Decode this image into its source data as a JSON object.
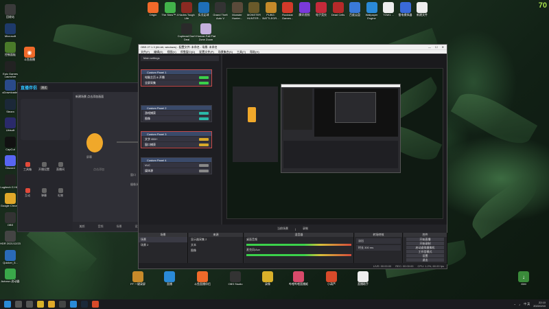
{
  "desktop": {
    "corner_number": "70",
    "top_icons": [
      {
        "label": "Origin",
        "color": "#f06a2a",
        "name": "origin-icon"
      },
      {
        "label": "The Sims™ 4",
        "color": "#42b34a",
        "name": "sims-icon"
      },
      {
        "label": "Hades Tough Life",
        "color": "#8a2a22",
        "name": "hades-icon"
      },
      {
        "label": "实况足球",
        "color": "#1e6fb8",
        "name": "football-icon"
      },
      {
        "label": "Grand Theft Auto V",
        "color": "#333",
        "name": "gta-icon"
      },
      {
        "label": "Monster Hunter...",
        "color": "#5a4a3a",
        "name": "monster-hunter-icon"
      },
      {
        "label": "MONSTER HUNTER...",
        "color": "#6a5a2a",
        "name": "monster-hunter-2-icon"
      },
      {
        "label": "PUBG: BATTLEGR...",
        "color": "#c48a2a",
        "name": "pubg-icon"
      },
      {
        "label": "Rockstar Games...",
        "color": "#d23a2a",
        "name": "rockstar-icon"
      },
      {
        "label": "腾讯视频",
        "color": "#7a3adb",
        "name": "tencent-video-icon"
      },
      {
        "label": "电子竞技",
        "color": "#c42a3a",
        "name": "esports-icon"
      },
      {
        "label": "Dead Cells",
        "color": "#b62a2a",
        "name": "dead-cells-icon"
      },
      {
        "label": "百度云盘",
        "color": "#3a7ad8",
        "name": "baidu-cloud-icon"
      },
      {
        "label": "Wallpaper Engine",
        "color": "#2a8ad8",
        "name": "wallpaper-engine-icon"
      },
      {
        "label": "TGW1 ...",
        "color": "#eee",
        "name": "file-icon"
      },
      {
        "label": "雷电模拟器",
        "color": "#3a6ad8",
        "name": "emulator-icon"
      },
      {
        "label": "新建文件",
        "color": "#eee",
        "name": "new-file-icon"
      }
    ],
    "top_row2_icons": [
      {
        "label": "Cuphead Don't Deal",
        "color": "#2a2a2a",
        "name": "cuphead-icon"
      },
      {
        "label": "Human Fall Flat Zone Zoom",
        "color": "#c4b0dd",
        "name": "human-fall-flat-icon"
      }
    ],
    "left_icons": [
      {
        "label": "回收站",
        "color": "#3a3a3a",
        "name": "recycle-bin-icon"
      },
      {
        "label": "Microsoft",
        "color": "#1e3a6a",
        "name": "microsoft-icon"
      },
      {
        "label": "控制面板",
        "color": "#4a7a2a",
        "name": "control-panel-icon"
      },
      {
        "label": "Epic Games Launcher",
        "color": "#222",
        "name": "epic-games-icon"
      },
      {
        "label": "uDownloader",
        "color": "#2a4a8a",
        "name": "downloader-icon"
      },
      {
        "label": "Steam",
        "color": "#1b2838",
        "name": "steam-icon"
      },
      {
        "label": "Ubisoft",
        "color": "#2a2a6a",
        "name": "ubisoft-icon"
      },
      {
        "label": "CapCut",
        "color": "#111",
        "name": "capcut-icon"
      },
      {
        "label": "Discord",
        "color": "#5865f2",
        "name": "discord-icon"
      },
      {
        "label": "Logitech G HUB",
        "color": "#222",
        "name": "logitech-icon"
      },
      {
        "label": "Google Chrome",
        "color": "#e0a82a",
        "name": "chrome-icon"
      },
      {
        "label": "OBS",
        "color": "#333",
        "name": "obs-desktop-icon"
      },
      {
        "label": "HDR 2021/12/23",
        "color": "#444",
        "name": "hdr-icon"
      },
      {
        "label": "Quicker_5...",
        "color": "#2a6ab8",
        "name": "quicker-icon"
      },
      {
        "label": "Autorun 启动器",
        "color": "#3aa84a",
        "name": "autorun-icon"
      }
    ],
    "left_icon2": {
      "label": "斗鱼直播",
      "color": "#f06a2a",
      "name": "douyu-icon"
    },
    "bottom_icons": [
      {
        "label": "FF 一键录屏",
        "color": "#c88a2a",
        "name": "ff-icon"
      },
      {
        "label": "直播",
        "color": "#2a8ad8",
        "name": "live-icon"
      },
      {
        "label": "斗鱼直播伴侣",
        "color": "#f06a2a",
        "name": "douyu-companion-icon"
      },
      {
        "label": "OBS Studio",
        "color": "#333",
        "name": "obs-studio-icon"
      },
      {
        "label": "录像",
        "color": "#d8b02a",
        "name": "recorder-icon"
      },
      {
        "label": "哔哩哔哩直播姬",
        "color": "#d84a6a",
        "name": "bili-live-icon"
      },
      {
        "label": "小葫芦",
        "color": "#d84a2a",
        "name": "hulu-icon"
      },
      {
        "label": "直播助手",
        "color": "#eee",
        "name": "assistant-icon"
      }
    ],
    "right_icon": {
      "label": "IDM",
      "color": "#3a8a3a",
      "name": "idm-icon"
    }
  },
  "live_app": {
    "logo": "直播伴侣",
    "badge": "测试",
    "scene_title": "新建场景 点击添加画面",
    "side_items": [
      {
        "label": "工具箱",
        "name": "tool-toolbox"
      },
      {
        "label": "开播设置",
        "name": "tool-live-settings"
      },
      {
        "label": "直播间",
        "name": "tool-live-room"
      },
      {
        "label": "互动",
        "name": "tool-interaction"
      },
      {
        "label": "弹幕",
        "name": "tool-danmaku"
      },
      {
        "label": "礼物",
        "name": "tool-gift"
      }
    ],
    "main_labels": {
      "screen": "屏幕",
      "window": "窗口",
      "camera": "摄像头",
      "hint": "点击添加"
    },
    "footer": [
      "美颜",
      "音频",
      "场景",
      "设置"
    ]
  },
  "obs": {
    "title": "OBS 27.1.3 (64-bit, windows) - 配置文件: 未命名 - 场景: 未命名",
    "menu": [
      "文件(F)",
      "编辑(E)",
      "视图(V)",
      "停靠窗口(D)",
      "配置文件(P)",
      "场景集合(S)",
      "工具(T)",
      "帮助(H)"
    ],
    "src_header": "Main settings",
    "cards": [
      {
        "title": "Custom Panel 1",
        "rows": [
          "电脑主页 & 开播",
          "全屏采集"
        ],
        "selected": true,
        "pill": "#3ad04a"
      },
      {
        "title": "Custom Panel 2",
        "rows": [
          "游戏捕获",
          "图像"
        ],
        "selected": false,
        "pill": "#2ab8a8"
      },
      {
        "title": "Custom Panel 3",
        "rows": [
          "文字 GDI+",
          "窗口捕获"
        ],
        "selected": true,
        "pill": "#d8a82a"
      },
      {
        "title": "Custom Panel 4",
        "rows": [
          "VLC",
          "媒体源"
        ],
        "selected": false,
        "pill": "#888"
      }
    ],
    "label_bar": [
      "当前场景",
      "|",
      "录制"
    ],
    "docks": [
      {
        "title": "场景",
        "items": [
          "场景",
          "场景 2"
        ]
      },
      {
        "title": "来源",
        "items": [
          "显示器采集 2",
          "文本",
          "图像"
        ]
      },
      {
        "title": "混音器",
        "items": [
          "桌面音频",
          "麦克风/Aux"
        ]
      },
      {
        "title": "转场特效",
        "items": [
          "淡出",
          "时长 300 ms"
        ]
      },
      {
        "title": "控件",
        "items": [
          "开始直播",
          "开始录制",
          "启动虚拟摄像机",
          "工作室模式",
          "设置",
          "退出"
        ]
      }
    ],
    "status": [
      "LIVE: 00:00:00",
      "REC: 00:00:00",
      "CPU: 1.2%, 60.00 fps"
    ]
  },
  "taskbar": {
    "icons": [
      "start-icon",
      "search-icon",
      "task-view-icon",
      "explorer-icon",
      "chrome-task-icon",
      "obs-task-icon",
      "edge-task-icon",
      "steam-task-icon",
      "live-task-icon"
    ],
    "time": "22:10",
    "date": "2022/2/10",
    "lang": "中 英"
  }
}
